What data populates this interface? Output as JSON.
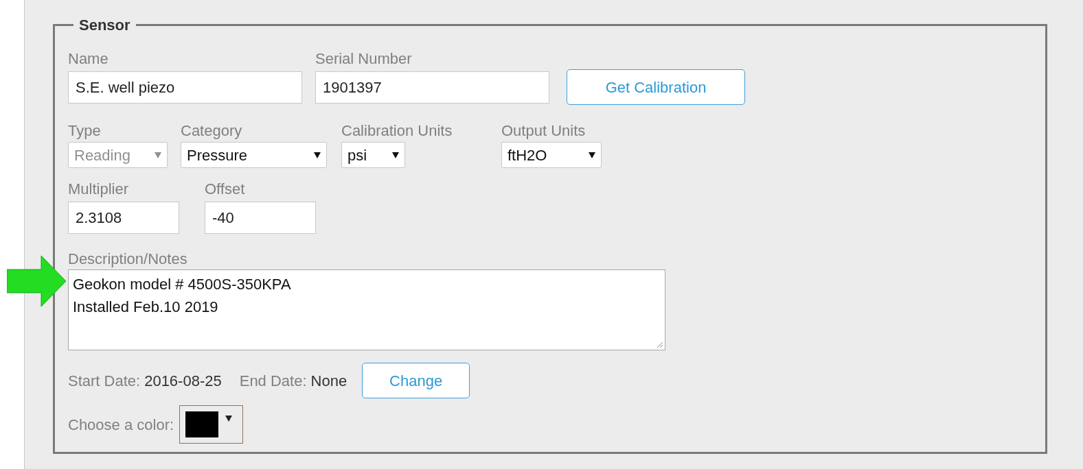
{
  "fieldset": {
    "legend": "Sensor"
  },
  "row1": [
    {
      "kind": "input",
      "label": "Name",
      "value": "S.E. well piezo"
    },
    {
      "kind": "input",
      "label": "Serial Number",
      "value": "1901397"
    },
    {
      "kind": "button",
      "text": "Get Calibration"
    }
  ],
  "row2": [
    {
      "kind": "select",
      "label": "Type",
      "value": "Reading",
      "disabled": true
    },
    {
      "kind": "select",
      "label": "Category",
      "value": "Pressure",
      "disabled": false
    },
    {
      "kind": "select",
      "label": "Calibration Units",
      "value": "psi",
      "disabled": false
    },
    {
      "kind": "select",
      "label": "Output Units",
      "value": "ftH2O",
      "disabled": false
    }
  ],
  "row3": [
    {
      "kind": "input",
      "label": "Multiplier",
      "value": "2.3108"
    },
    {
      "kind": "input",
      "label": "Offset",
      "value": "-40"
    }
  ],
  "description": {
    "label": "Description/Notes",
    "value": "Geokon model # 4500S-350KPA\nInstalled Feb.10 2019"
  },
  "dates": {
    "start_label": "Start Date:",
    "start_value": "2016-08-25",
    "end_label": "End Date:",
    "end_value": "None",
    "button": "Change"
  },
  "color_picker": {
    "label": "Choose a color:",
    "color": "#000000"
  }
}
